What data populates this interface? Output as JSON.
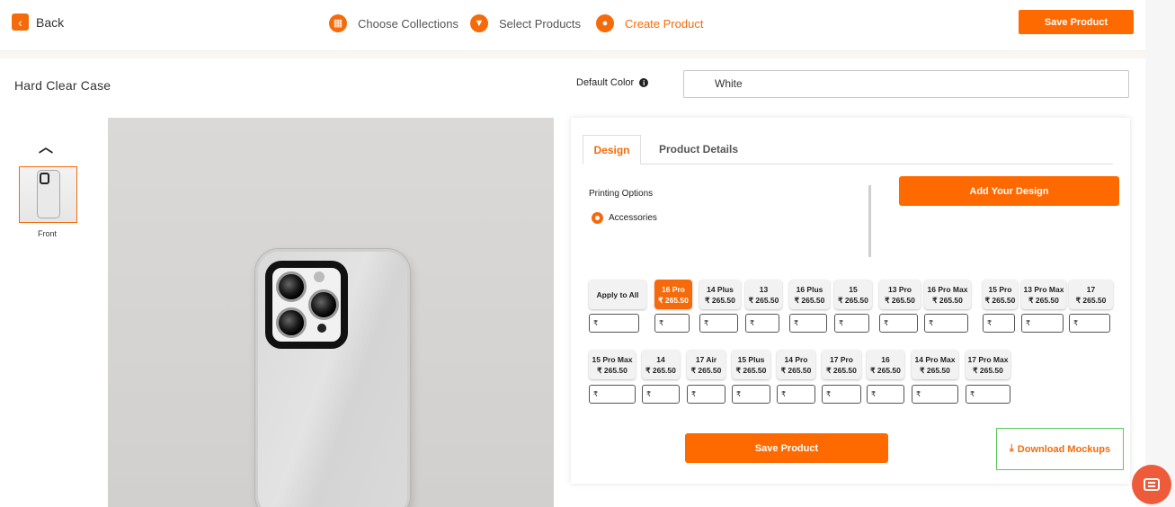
{
  "header": {
    "back_label": "Back",
    "steps": [
      {
        "label": "Choose Collections",
        "icon": "grid-icon"
      },
      {
        "label": "Select Products",
        "icon": "tshirt-icon"
      },
      {
        "label": "Create Product",
        "icon": "palette-icon"
      }
    ],
    "save_label": "Save Product"
  },
  "product": {
    "title": "Hard Clear Case",
    "default_color_label": "Default Color",
    "default_color_value": "White",
    "thumbnail_label": "Front"
  },
  "panel": {
    "tabs": [
      "Design",
      "Product Details"
    ],
    "printing_options_label": "Printing Options",
    "printing_option": "Accessories",
    "add_design_label": "Add Your Design",
    "apply_all_label": "Apply to All",
    "variants_row1": [
      {
        "name": "16 Pro",
        "price": "₹ 265.50"
      },
      {
        "name": "14 Plus",
        "price": "₹ 265.50"
      },
      {
        "name": "13",
        "price": "₹ 265.50"
      },
      {
        "name": "16 Plus",
        "price": "₹ 265.50"
      },
      {
        "name": "15",
        "price": "₹ 265.50"
      },
      {
        "name": "13 Pro",
        "price": "₹ 265.50"
      },
      {
        "name": "16 Pro Max",
        "price": "₹ 265.50"
      },
      {
        "name": "15 Pro",
        "price": "₹ 265.50"
      },
      {
        "name": "13 Pro Max",
        "price": "₹ 265.50"
      },
      {
        "name": "17",
        "price": "₹ 265.50"
      }
    ],
    "variants_row2": [
      {
        "name": "15 Pro Max",
        "price": "₹ 265.50"
      },
      {
        "name": "14",
        "price": "₹ 265.50"
      },
      {
        "name": "17 Air",
        "price": "₹ 265.50"
      },
      {
        "name": "15 Plus",
        "price": "₹ 265.50"
      },
      {
        "name": "14 Pro",
        "price": "₹ 265.50"
      },
      {
        "name": "17 Pro",
        "price": "₹ 265.50"
      },
      {
        "name": "16",
        "price": "₹ 265.50"
      },
      {
        "name": "14 Pro Max",
        "price": "₹ 265.50"
      },
      {
        "name": "17 Pro Max",
        "price": "₹ 265.50"
      }
    ],
    "input_prefix": "₹",
    "save_label": "Save Product",
    "download_label": "Download Mockups"
  },
  "colors": {
    "accent": "#ff6a00",
    "download_border": "#5ec85e"
  }
}
